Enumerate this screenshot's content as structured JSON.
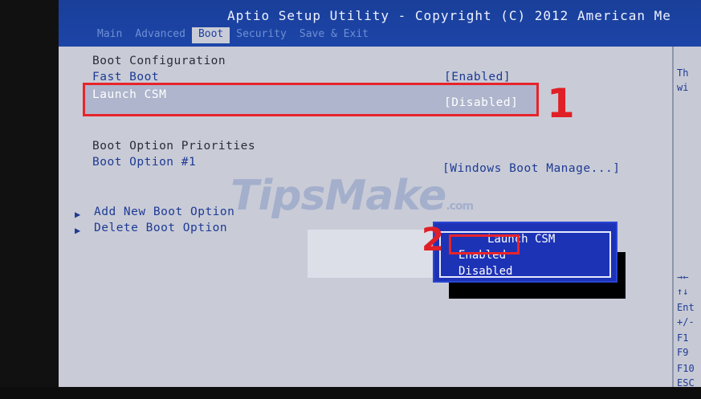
{
  "title": "Aptio Setup Utility - Copyright (C) 2012 American Me",
  "tabs": [
    "Main",
    "Advanced",
    "Boot",
    "Security",
    "Save & Exit"
  ],
  "active_tab": "Boot",
  "main": {
    "boot_configuration": "Boot Configuration",
    "fast_boot": {
      "label": "Fast Boot",
      "value": "[Enabled]"
    },
    "launch_csm": {
      "label": "Launch CSM",
      "value": "[Disabled]"
    },
    "boot_option_priorities": "Boot Option Priorities",
    "boot_option_1": {
      "label": "Boot Option #1",
      "value": "[Windows Boot Manage...]"
    },
    "add_new_boot_option": "Add New Boot Option",
    "delete_boot_option": "Delete Boot Option"
  },
  "popup": {
    "title": "Launch CSM",
    "options": [
      "Enabled",
      "Disabled"
    ],
    "highlighted": "Enabled"
  },
  "help_panel": {
    "lines_top": [
      "Th",
      "wi"
    ],
    "lines_bottom": [
      "→←",
      "↑↓",
      "Ent",
      "+/-",
      "F1",
      "F9",
      "F10",
      "ESC"
    ]
  },
  "annotations": {
    "step1": "1",
    "step2": "2"
  },
  "watermark": {
    "text": "TipsMake",
    "suffix": ".com"
  },
  "colors": {
    "background": "#c9ccd7",
    "titlebar": "#1c45a8",
    "text": "#1e3a93",
    "popup": "#1d33b6",
    "annotation": "#e01f26"
  }
}
